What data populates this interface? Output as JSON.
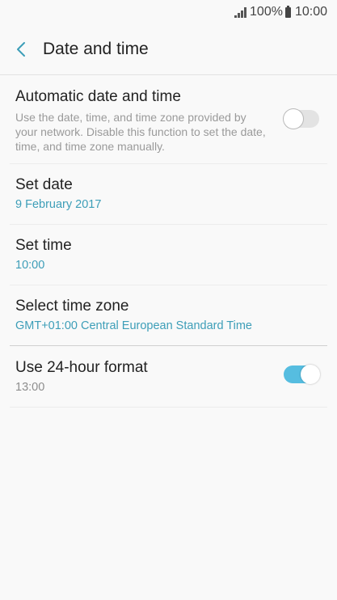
{
  "status_bar": {
    "battery_text": "100%",
    "time": "10:00",
    "signal_icon": "signal-bars-icon",
    "battery_icon": "battery-icon"
  },
  "header": {
    "title": "Date and time",
    "back_icon": "chevron-left-icon"
  },
  "settings": {
    "automatic": {
      "title": "Automatic date and time",
      "description": "Use the date, time, and time zone provided by your network. Disable this function to set the date, time, and time zone manually.",
      "enabled": false
    },
    "set_date": {
      "title": "Set date",
      "value": "9 February 2017"
    },
    "set_time": {
      "title": "Set time",
      "value": "10:00"
    },
    "time_zone": {
      "title": "Select time zone",
      "value": "GMT+01:00 Central European Standard Time"
    },
    "hour_format": {
      "title": "Use 24-hour format",
      "value": "13:00",
      "enabled": true
    }
  },
  "colors": {
    "accent": "#3d9eb8",
    "toggle_on": "#56bde0",
    "background": "#f9f9f9"
  }
}
